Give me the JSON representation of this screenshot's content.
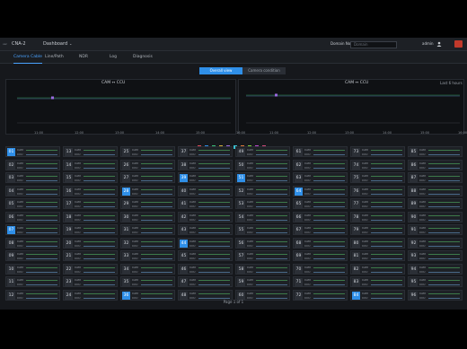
{
  "topbar": {
    "brand": "CNA-2",
    "brand_prefix": "ver",
    "dashboard": "Dashboard",
    "domain_label": "Domain No.",
    "domain_placeholder": "Domain",
    "user": "admin"
  },
  "tabs": [
    "Camera Cable",
    "Line/Path",
    "NDR",
    "Log",
    "Diagnosis"
  ],
  "subtabs": [
    "Overall view",
    "Camera condition"
  ],
  "charts": [
    {
      "title": "CAM ↔ CCU",
      "note": ""
    },
    {
      "title": "CAM ↔ CCU",
      "note": "Last 6 hours"
    }
  ],
  "chart_times_left": [
    "11:00",
    "12:00",
    "13:00",
    "14:00",
    "15:00",
    "16:00"
  ],
  "chart_times_right": [
    "11:00",
    "12:00",
    "13:00",
    "14:00",
    "15:00",
    "16:00"
  ],
  "legend_colors": [
    "#e04b5a",
    "#2f8fe8",
    "#39c07a",
    "#d2b13a",
    "#9a6ae0",
    "#3ac0d0",
    "#e07a3a",
    "#7ad03a",
    "#c04ad0",
    "#d04a7a"
  ],
  "cells": {
    "line1": "CAM",
    "line2": "CCU",
    "columns": [
      {
        "numbers": [
          "01",
          "02",
          "03",
          "04",
          "05",
          "06",
          "07",
          "08",
          "09",
          "10",
          "11",
          "12"
        ],
        "highlight": [
          "01",
          "07"
        ]
      },
      {
        "numbers": [
          "13",
          "14",
          "15",
          "16",
          "17",
          "18",
          "19",
          "20",
          "21",
          "22",
          "23",
          "24"
        ],
        "highlight": []
      },
      {
        "numbers": [
          "25",
          "26",
          "27",
          "28",
          "29",
          "30",
          "31",
          "32",
          "33",
          "34",
          "35",
          "36"
        ],
        "highlight": [
          "28",
          "36"
        ]
      },
      {
        "numbers": [
          "37",
          "38",
          "39",
          "40",
          "41",
          "42",
          "43",
          "44",
          "45",
          "46",
          "47",
          "48"
        ],
        "highlight": [
          "39",
          "44"
        ]
      },
      {
        "numbers": [
          "49",
          "50",
          "51",
          "52",
          "53",
          "54",
          "55",
          "56",
          "57",
          "58",
          "59",
          "60"
        ],
        "highlight": [
          "51"
        ]
      },
      {
        "numbers": [
          "61",
          "62",
          "63",
          "64",
          "65",
          "66",
          "67",
          "68",
          "69",
          "70",
          "71",
          "72"
        ],
        "highlight": [
          "64"
        ]
      },
      {
        "numbers": [
          "73",
          "74",
          "75",
          "76",
          "77",
          "78",
          "79",
          "80",
          "81",
          "82",
          "83",
          "84"
        ],
        "highlight": [
          "84"
        ]
      },
      {
        "numbers": [
          "85",
          "86",
          "87",
          "88",
          "89",
          "90",
          "91",
          "92",
          "93",
          "94",
          "95",
          "96"
        ],
        "highlight": []
      }
    ]
  },
  "pager": "Page 1 of 1"
}
